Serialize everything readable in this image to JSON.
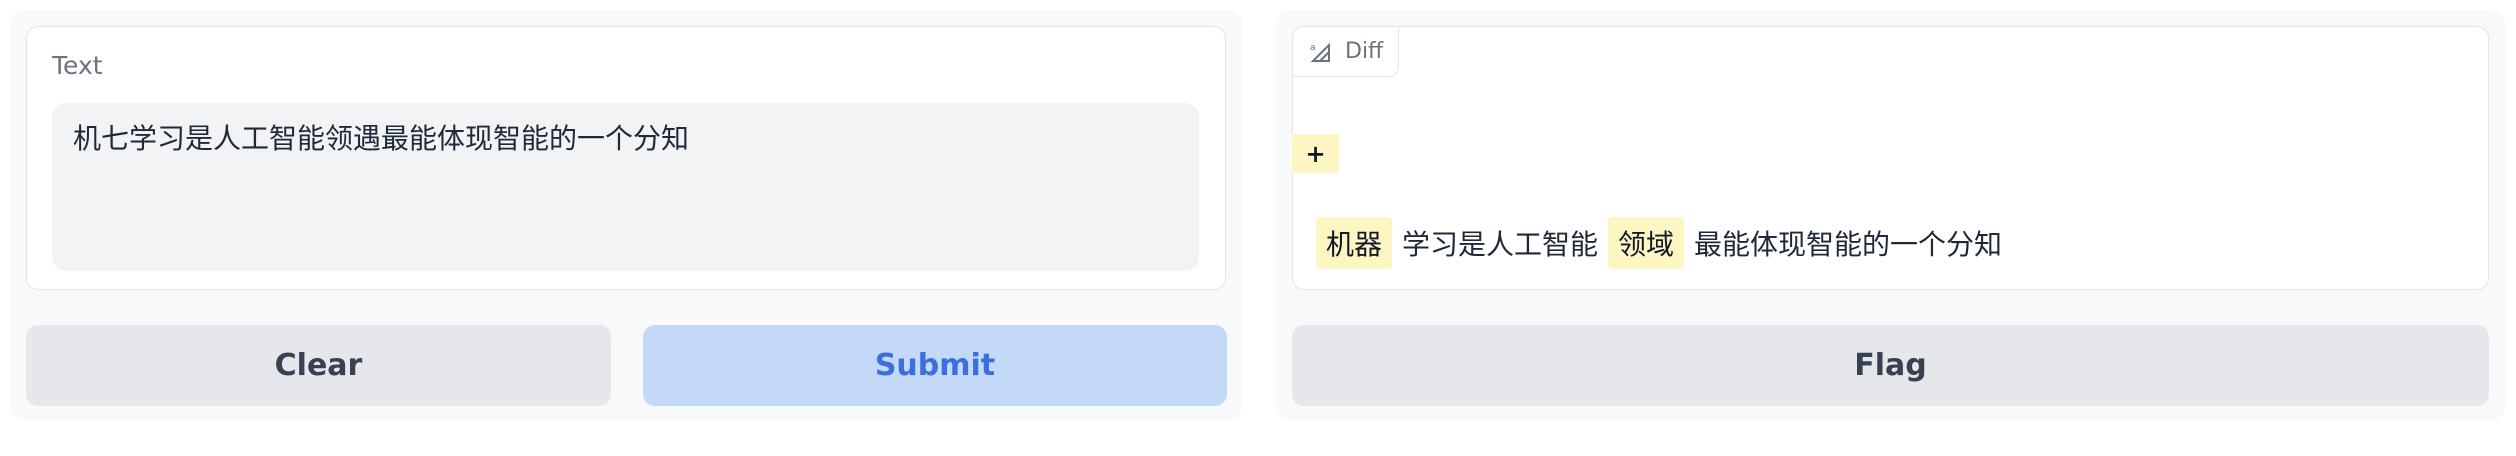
{
  "input": {
    "label": "Text",
    "value": "机七学习是人工智能领遇最能体现智能的一个分知"
  },
  "buttons": {
    "clear": "Clear",
    "submit": "Submit",
    "flag": "Flag"
  },
  "output": {
    "tab_label": "Diff",
    "legend_symbol": "+",
    "segments": [
      {
        "text": "机器",
        "highlight": true
      },
      {
        "text": "学习是人工智能",
        "highlight": false
      },
      {
        "text": "领域",
        "highlight": true
      },
      {
        "text": "最能体现智能的一个分知",
        "highlight": false
      }
    ]
  },
  "colors": {
    "highlight": "#fdf6c3",
    "submit_bg": "#c4d8f7",
    "submit_text": "#3b6fd9",
    "secondary_bg": "#e5e7eb"
  }
}
